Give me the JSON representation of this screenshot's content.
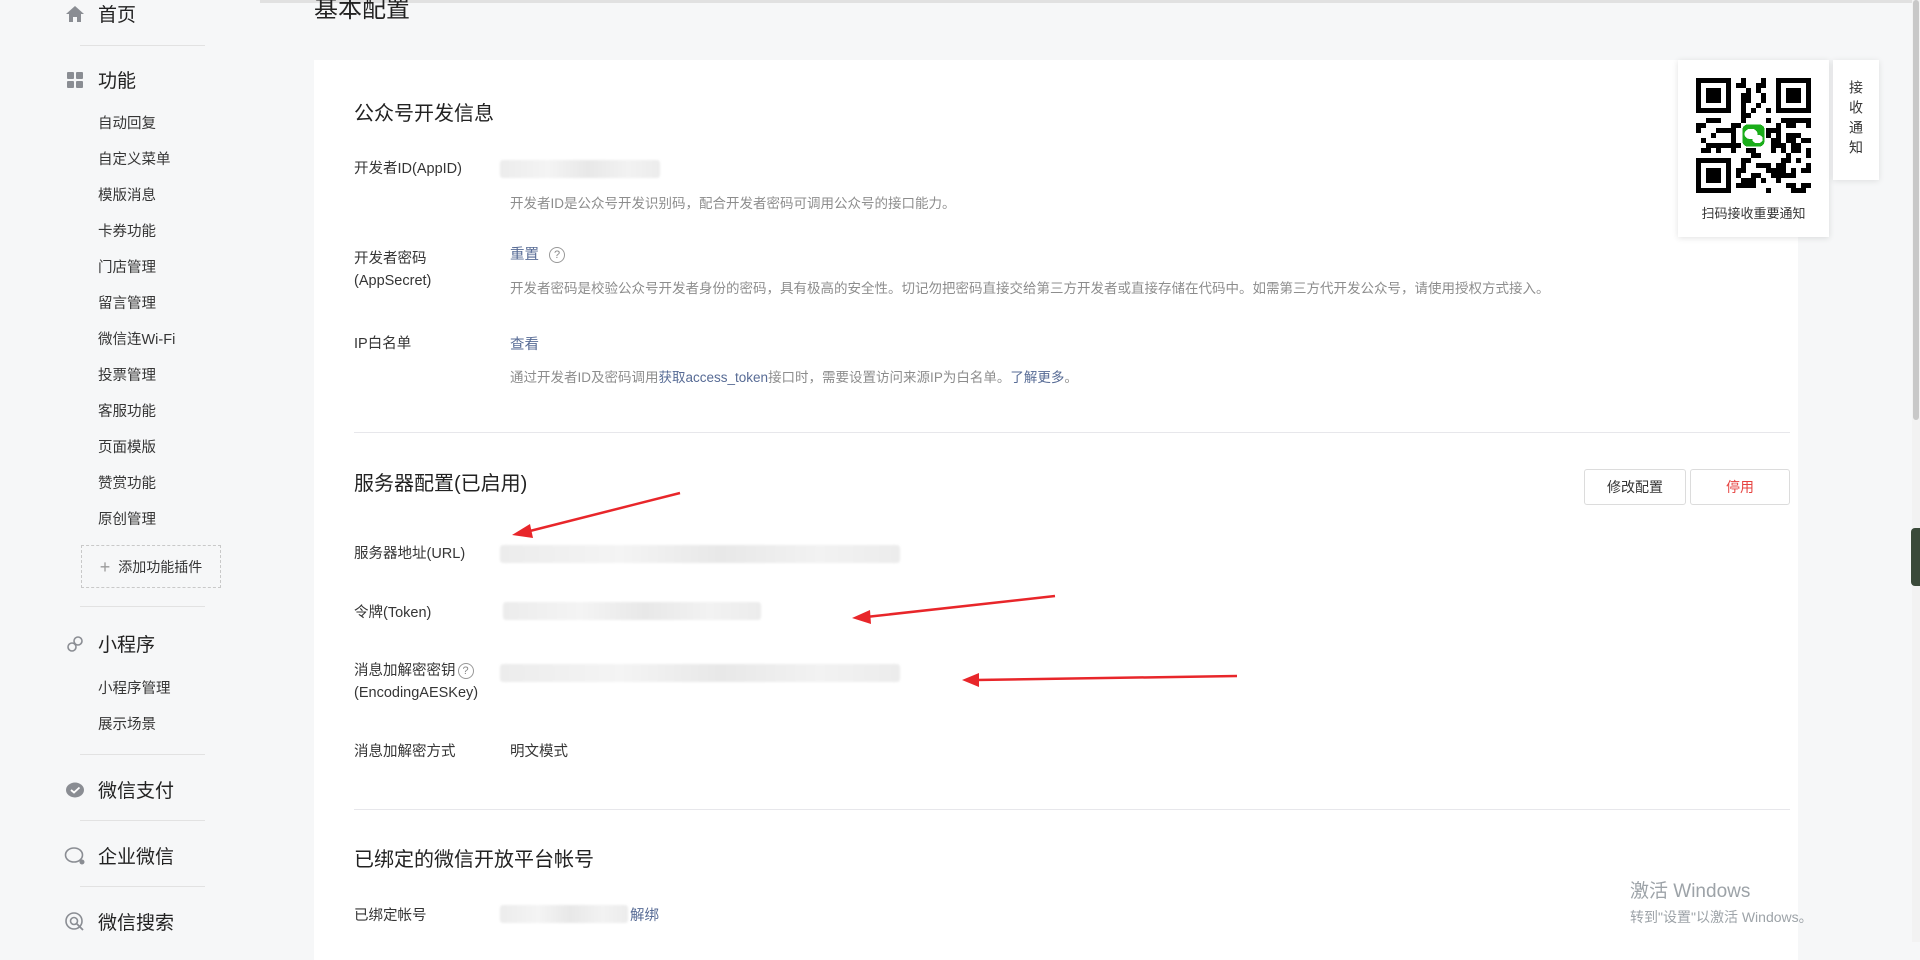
{
  "sidebar": {
    "home": {
      "label": "首页",
      "icon": "home-icon"
    },
    "features": {
      "label": "功能",
      "icon": "grid-icon",
      "items": [
        "自动回复",
        "自定义菜单",
        "模版消息",
        "卡券功能",
        "门店管理",
        "留言管理",
        "微信连Wi-Fi",
        "投票管理",
        "客服功能",
        "页面模版",
        "赞赏功能",
        "原创管理"
      ],
      "add_plugin": "添加功能插件"
    },
    "miniprogram": {
      "label": "小程序",
      "icon": "miniprogram-icon",
      "items": [
        "小程序管理",
        "展示场景"
      ]
    },
    "wechat_pay": {
      "label": "微信支付",
      "icon": "wechat-pay-icon"
    },
    "wework": {
      "label": "企业微信",
      "icon": "wework-icon"
    },
    "wechat_search": {
      "label": "微信搜索",
      "icon": "search-icon"
    }
  },
  "page_title": "基本配置",
  "dev_info": {
    "title": "公众号开发信息",
    "appid_label": "开发者ID(AppID)",
    "appid_desc": "开发者ID是公众号开发识别码，配合开发者密码可调用公众号的接口能力。",
    "secret_label_1": "开发者密码",
    "secret_label_2": "(AppSecret)",
    "secret_reset": "重置",
    "secret_desc": "开发者密码是校验公众号开发者身份的密码，具有极高的安全性。切记勿把密码直接交给第三方开发者或直接存储在代码中。如需第三方代开发公众号，请使用授权方式接入。",
    "ip_label": "IP白名单",
    "ip_view": "查看",
    "ip_desc_1": "通过开发者ID及密码调用",
    "ip_desc_link": "获取access_token",
    "ip_desc_2": "接口时，需要设置访问来源IP为白名单。",
    "ip_learn_more": "了解更多",
    "ip_desc_end": "。"
  },
  "server": {
    "title": "服务器配置(已启用)",
    "modify_button": "修改配置",
    "disable_button": "停用",
    "url_label": "服务器地址(URL)",
    "token_label": "令牌(Token)",
    "aes_label_1": "消息加解密密钥",
    "aes_label_2": "(EncodingAESKey)",
    "mode_label": "消息加解密方式",
    "mode_value": "明文模式"
  },
  "bound": {
    "title": "已绑定的微信开放平台帐号",
    "label": "已绑定帐号",
    "unbind": "解绑"
  },
  "qr_notify": {
    "caption": "扫码接收重要通知",
    "tab": "接收通知"
  },
  "watermark": {
    "line1": "激活 Windows",
    "line2": "转到\"设置\"以激活 Windows。"
  },
  "colors": {
    "link": "#576b95",
    "danger": "#e64340",
    "arrow": "#e8262a",
    "wechat_green": "#1aad19"
  }
}
